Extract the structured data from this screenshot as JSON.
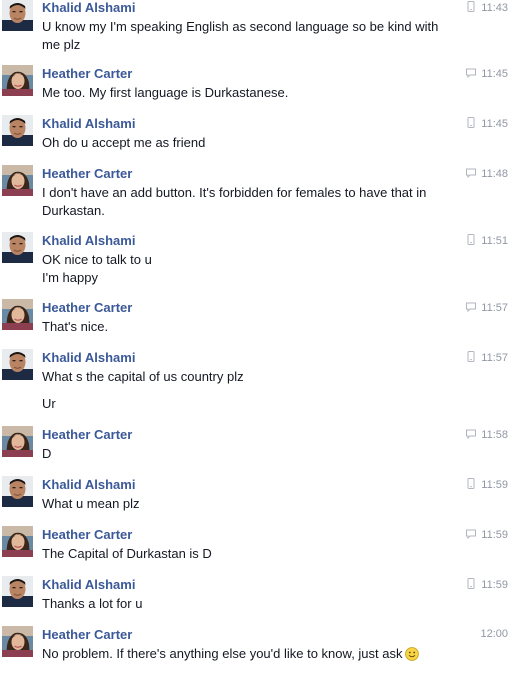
{
  "people": {
    "khalid": "Khalid Alshami",
    "heather": "Heather Carter"
  },
  "icons": {
    "mobile": "mobile-phone-icon",
    "chat": "chat-bubble-icon",
    "smile": "smiley-emoji-icon"
  },
  "colors": {
    "name": "#3b5998",
    "text": "#141823",
    "meta": "#9197a3"
  },
  "messages": [
    {
      "sender": "Khalid Alshami",
      "via": "mobile",
      "time": "11:43",
      "lines": [
        "U know my I'm speaking English as second language so be kind with",
        "me plz"
      ]
    },
    {
      "sender": "Heather Carter",
      "via": "chat",
      "time": "11:45",
      "lines": [
        "Me too. My first language is Durkastanese."
      ]
    },
    {
      "sender": "Khalid Alshami",
      "via": "mobile",
      "time": "11:45",
      "lines": [
        "Oh do u accept me as friend"
      ]
    },
    {
      "sender": "Heather Carter",
      "via": "chat",
      "time": "11:48",
      "lines": [
        "I don't have an add button. It's forbidden for females to have that in",
        "Durkastan."
      ]
    },
    {
      "sender": "Khalid Alshami",
      "via": "mobile",
      "time": "11:51",
      "lines": [
        "OK nice to talk to u",
        "I'm happy"
      ]
    },
    {
      "sender": "Heather Carter",
      "via": "chat",
      "time": "11:57",
      "lines": [
        "That's nice."
      ]
    },
    {
      "sender": "Khalid Alshami",
      "via": "mobile",
      "time": "11:57",
      "lines": [
        "What s the capital of us country plz",
        "Ur"
      ]
    },
    {
      "sender": "Heather Carter",
      "via": "chat",
      "time": "11:58",
      "lines": [
        "D"
      ]
    },
    {
      "sender": "Khalid Alshami",
      "via": "mobile",
      "time": "11:59",
      "lines": [
        "What u mean plz"
      ]
    },
    {
      "sender": "Heather Carter",
      "via": "chat",
      "time": "11:59",
      "lines": [
        "The Capital of Durkastan is D"
      ]
    },
    {
      "sender": "Khalid Alshami",
      "via": "mobile",
      "time": "11:59",
      "lines": [
        "Thanks a lot for u"
      ]
    },
    {
      "sender": "Heather Carter",
      "via": "none",
      "time": "12:00",
      "lines": [
        "No problem. If there's anything else you'd like to know, just ask"
      ],
      "emoji": "smile"
    }
  ]
}
